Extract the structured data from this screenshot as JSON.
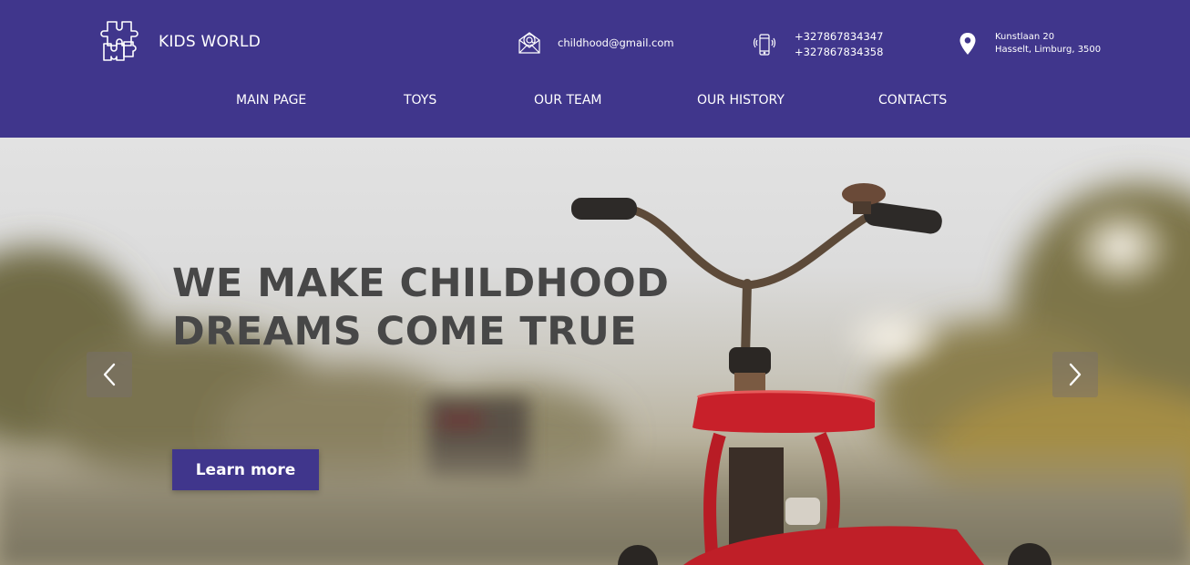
{
  "brand": {
    "name": "KIDS WORLD",
    "logo_icon": "puzzle-icon"
  },
  "contacts": {
    "email": {
      "icon": "mail-icon",
      "value": "childhood@gmail.com"
    },
    "phone": {
      "icon": "smartphone-icon",
      "numbers": [
        "+327867834347",
        "+327867834358"
      ]
    },
    "address": {
      "icon": "map-pin-icon",
      "lines": [
        "Kunstlaan 20",
        "Hasselt, Limburg, 3500"
      ]
    }
  },
  "nav": {
    "items": [
      {
        "label": "MAIN PAGE"
      },
      {
        "label": "TOYS"
      },
      {
        "label": "OUR TEAM"
      },
      {
        "label": "OUR HISTORY"
      },
      {
        "label": "CONTACTS"
      }
    ]
  },
  "hero": {
    "title_lines": [
      "WE MAKE CHILDHOOD",
      "DREAMS COME TRUE"
    ],
    "cta_label": "Learn more",
    "prev_icon": "chevron-left-icon",
    "next_icon": "chevron-right-icon",
    "background_subject": "red-tricycle-photo"
  },
  "colors": {
    "brand_purple": "#40368c",
    "hero_title": "#474747",
    "header_text": "#ffffff",
    "tricycle_red": "#c8202a"
  }
}
